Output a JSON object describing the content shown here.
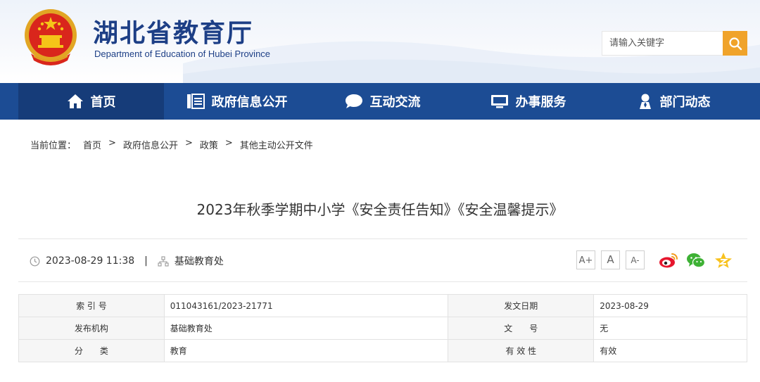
{
  "header": {
    "title": "湖北省教育厅",
    "subtitle": "Department of Education of Hubei Province",
    "search": {
      "placeholder": "请输入关键字",
      "button_icon": "search-icon"
    }
  },
  "nav": {
    "items": [
      {
        "label": "首页",
        "icon": "home-icon",
        "active": true
      },
      {
        "label": "政府信息公开",
        "icon": "document-list-icon",
        "active": false
      },
      {
        "label": "互动交流",
        "icon": "chat-bubble-icon",
        "active": false
      },
      {
        "label": "办事服务",
        "icon": "monitor-icon",
        "active": false
      },
      {
        "label": "部门动态",
        "icon": "person-pin-icon",
        "active": false
      }
    ]
  },
  "breadcrumb": {
    "prefix": "当前位置：",
    "items": [
      "首页",
      "政府信息公开",
      "政策",
      "其他主动公开文件"
    ],
    "separator": ">"
  },
  "article": {
    "title": "2023年秋季学期中小学《安全责任告知》《安全温馨提示》",
    "datetime": "2023-08-29 11:38",
    "divider": "|",
    "source": "基础教育处",
    "font_sizes": [
      "A+",
      "A",
      "A-"
    ]
  },
  "info_table": {
    "rows": [
      [
        {
          "label": "索 引 号",
          "value": "011043161/2023-21771"
        },
        {
          "label": "发文日期",
          "value": "2023-08-29"
        }
      ],
      [
        {
          "label": "发布机构",
          "value": "基础教育处"
        },
        {
          "label": "文　　号",
          "value": "无"
        }
      ],
      [
        {
          "label": "分　　类",
          "value": "教育"
        },
        {
          "label": "有 效 性",
          "value": "有效"
        }
      ]
    ]
  },
  "colors": {
    "nav_bg": "#1c4c94",
    "nav_active": "#163c79",
    "title_blue": "#1d3f86",
    "search_accent": "#f0a32a"
  }
}
